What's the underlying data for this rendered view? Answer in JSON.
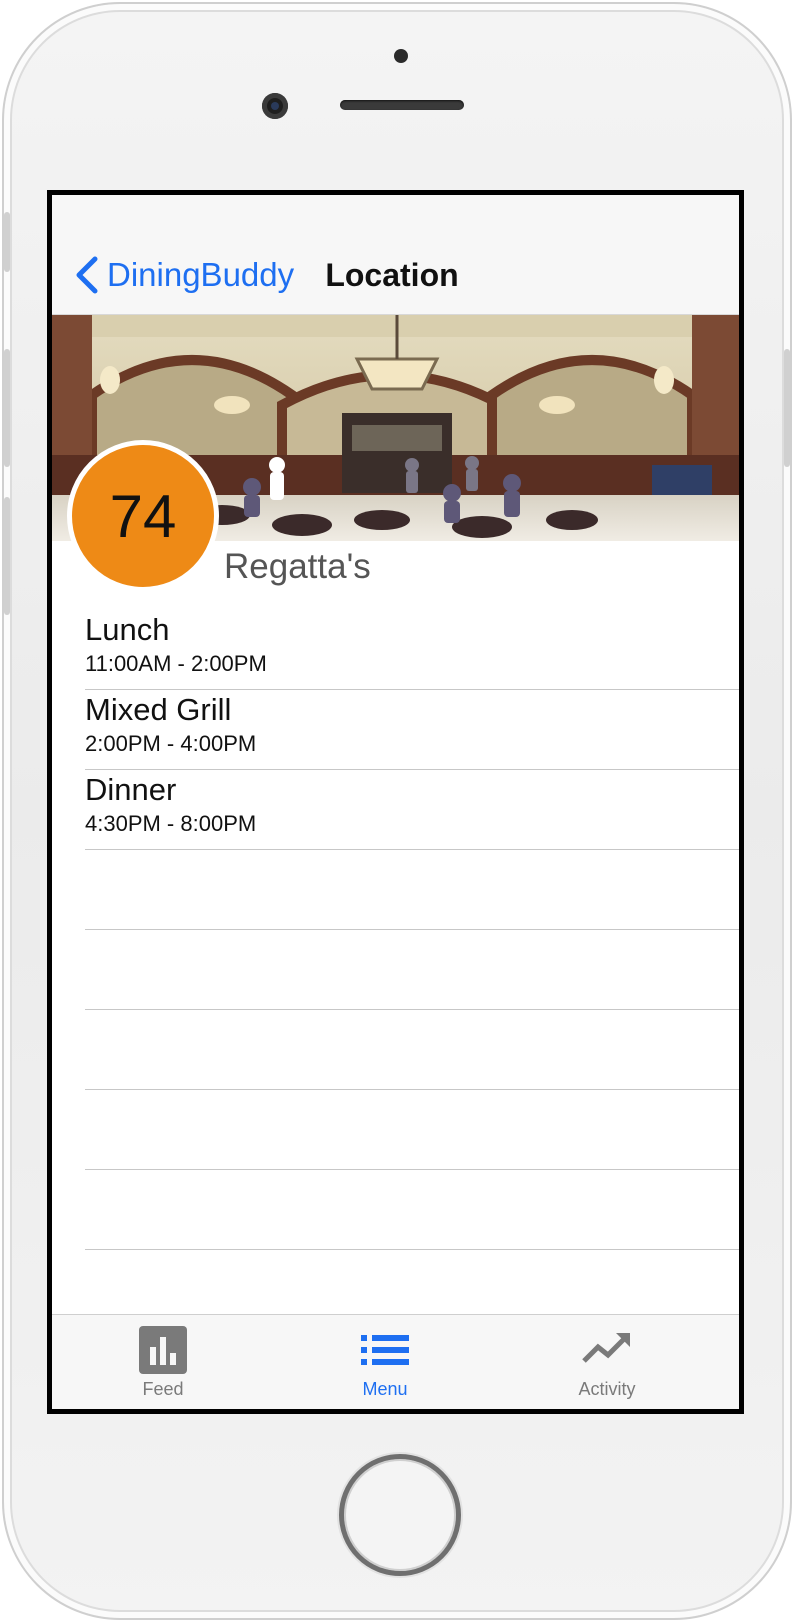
{
  "nav": {
    "back_label": "DiningBuddy",
    "title": "Location"
  },
  "location": {
    "score": "74",
    "name": "Regatta's"
  },
  "periods": [
    {
      "name": "Lunch",
      "hours": "11:00AM - 2:00PM"
    },
    {
      "name": "Mixed Grill",
      "hours": "2:00PM - 4:00PM"
    },
    {
      "name": "Dinner",
      "hours": "4:30PM - 8:00PM"
    }
  ],
  "tabs": [
    {
      "label": "Feed",
      "icon": "bar-chart-icon",
      "active": false
    },
    {
      "label": "Menu",
      "icon": "list-icon",
      "active": true
    },
    {
      "label": "Activity",
      "icon": "trend-icon",
      "active": false
    }
  ],
  "colors": {
    "accent": "#1e6ff1",
    "score_badge": "#ee8a16",
    "inactive_tab": "#7a7a7a"
  }
}
